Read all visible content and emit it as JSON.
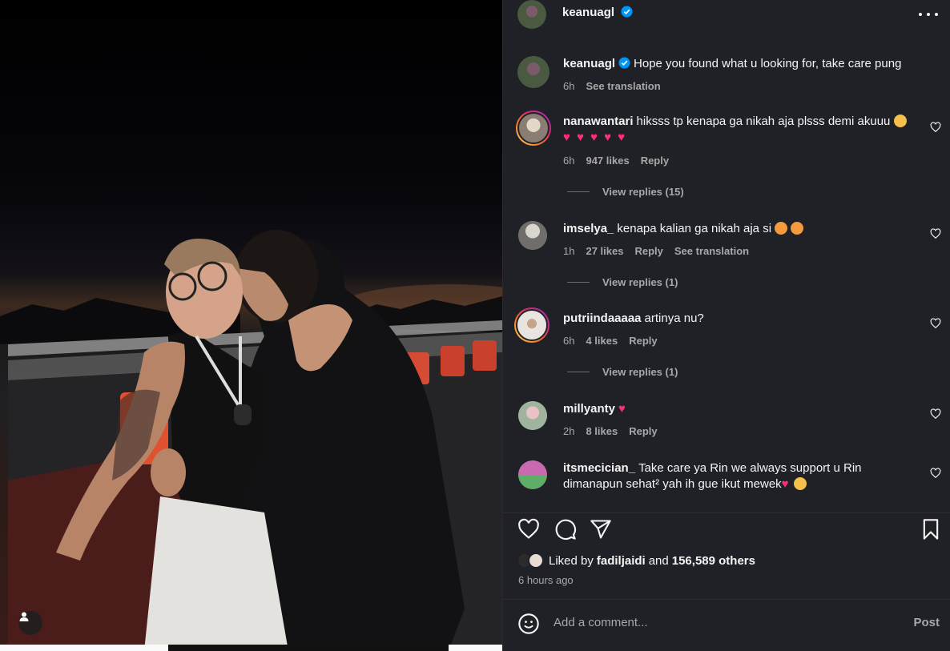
{
  "post": {
    "author": "keanuagl",
    "author_verified": true
  },
  "caption": {
    "author": "keanuagl",
    "text": "Hope you found what u looking for, take care pung",
    "time": "6h",
    "see_translation": "See translation"
  },
  "comments": [
    {
      "user": "nanawantari",
      "text": "hiksss tp kenapa ga nikah aja plsss demi akuuu",
      "text2": "♥ ♥ ♥ ♥ ♥",
      "time": "6h",
      "likes": "947 likes",
      "reply": "Reply",
      "view_replies": "View replies (15)"
    },
    {
      "user": "imselya_",
      "text": "kenapa kalian ga nikah aja si",
      "time": "1h",
      "likes": "27 likes",
      "reply": "Reply",
      "see_translation": "See translation",
      "view_replies": "View replies (1)"
    },
    {
      "user": "putriindaaaaa",
      "text": "artinya nu?",
      "time": "6h",
      "likes": "4 likes",
      "reply": "Reply",
      "view_replies": "View replies (1)"
    },
    {
      "user": "millyanty",
      "text": "♥",
      "time": "2h",
      "likes": "8 likes",
      "reply": "Reply"
    },
    {
      "user": "itsmecician_",
      "text": "Take care ya Rin we always support u Rin dimanapun sehat² yah ih gue ikut mewek",
      "heart": "♥"
    }
  ],
  "likes": {
    "prefix": "Liked by",
    "user": "fadiljaidi",
    "joiner": "and",
    "others": "156,589 others"
  },
  "time_ago": "6 hours ago",
  "add_comment": {
    "placeholder": "Add a comment...",
    "post": "Post"
  },
  "colors": {
    "panel_bg": "#202126",
    "text": "#f5f5f5",
    "muted": "#a8a8a8",
    "verified": "#0095f6",
    "heart_emoji": "#ff2d7a"
  },
  "icons": [
    "more-options-icon",
    "verified-badge-icon",
    "heart-icon",
    "comment-icon",
    "share-icon",
    "bookmark-icon",
    "emoji-icon",
    "user-tag-icon"
  ]
}
